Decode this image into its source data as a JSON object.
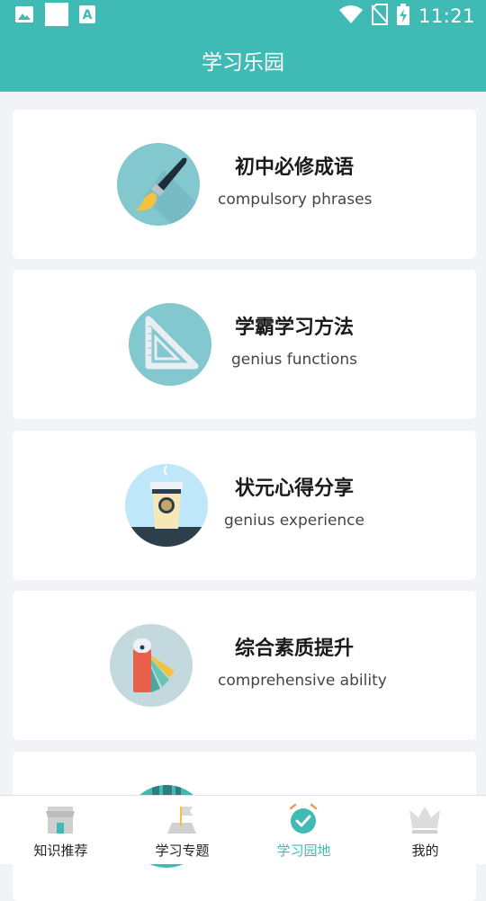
{
  "status_bar": {
    "time": "11:21",
    "icons": [
      "gallery-icon",
      "blank-square-icon",
      "font-icon",
      "wifi-icon",
      "no-sim-icon",
      "battery-charging-icon"
    ]
  },
  "header": {
    "title": "学习乐园"
  },
  "cards": [
    {
      "title": "初中必修成语",
      "subtitle": "compulsory phrases",
      "icon": "paintbrush-icon"
    },
    {
      "title": "学霸学习方法",
      "subtitle": "genius functions",
      "icon": "triangle-ruler-icon"
    },
    {
      "title": "状元心得分享",
      "subtitle": "genius experience",
      "icon": "coffee-cup-icon"
    },
    {
      "title": "综合素质提升",
      "subtitle": "comprehensive ability",
      "icon": "color-swatch-icon"
    },
    {
      "title": "",
      "subtitle": "",
      "icon": "city-icon"
    }
  ],
  "tabbar": {
    "tabs": [
      {
        "label": "知识推荐",
        "icon": "store-icon",
        "active": false
      },
      {
        "label": "学习专题",
        "icon": "flag-icon",
        "active": false
      },
      {
        "label": "学习园地",
        "icon": "alarm-check-icon",
        "active": true
      },
      {
        "label": "我的",
        "icon": "crown-icon",
        "active": false
      }
    ]
  },
  "colors": {
    "accent": "#40bab5",
    "background": "#f2f3f7",
    "card": "#ffffff"
  }
}
